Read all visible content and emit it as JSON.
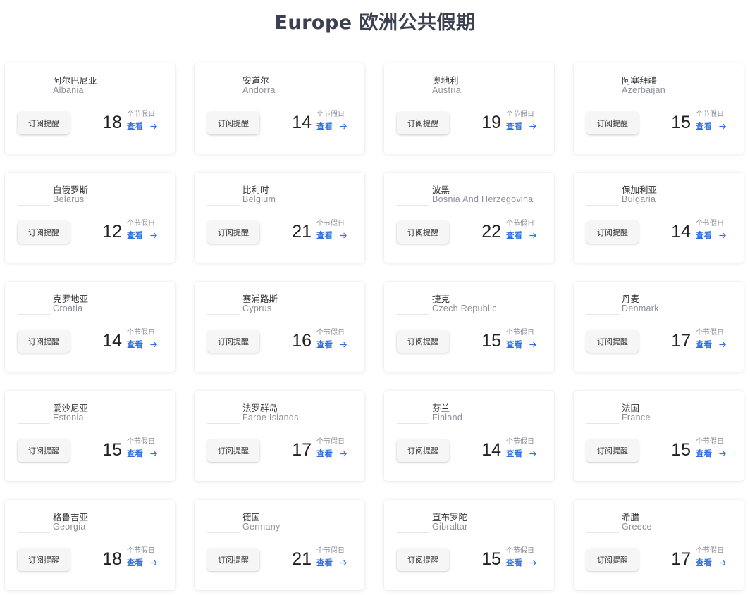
{
  "page": {
    "title": "Europe 欧洲公共假期"
  },
  "card_labels": {
    "subscribe": "订阅提醒",
    "holidays": "个节假日",
    "view": "查看"
  },
  "colors": {
    "link": "#2f6fde",
    "title": "#3b4150"
  },
  "countries": [
    {
      "cn": "阿尔巴尼亚",
      "en": "Albania",
      "count": "18"
    },
    {
      "cn": "安道尔",
      "en": "Andorra",
      "count": "14"
    },
    {
      "cn": "奥地利",
      "en": "Austria",
      "count": "19"
    },
    {
      "cn": "阿塞拜疆",
      "en": "Azerbaijan",
      "count": "15"
    },
    {
      "cn": "白俄罗斯",
      "en": "Belarus",
      "count": "12"
    },
    {
      "cn": "比利时",
      "en": "Belgium",
      "count": "21"
    },
    {
      "cn": "波黑",
      "en": "Bosnia And Herzegovina",
      "count": "22"
    },
    {
      "cn": "保加利亚",
      "en": "Bulgaria",
      "count": "14"
    },
    {
      "cn": "克罗地亚",
      "en": "Croatia",
      "count": "14"
    },
    {
      "cn": "塞浦路斯",
      "en": "Cyprus",
      "count": "16"
    },
    {
      "cn": "捷克",
      "en": "Czech Republic",
      "count": "15"
    },
    {
      "cn": "丹麦",
      "en": "Denmark",
      "count": "17"
    },
    {
      "cn": "爱沙尼亚",
      "en": "Estonia",
      "count": "15"
    },
    {
      "cn": "法罗群岛",
      "en": "Faroe Islands",
      "count": "17"
    },
    {
      "cn": "芬兰",
      "en": "Finland",
      "count": "14"
    },
    {
      "cn": "法国",
      "en": "France",
      "count": "15"
    },
    {
      "cn": "格鲁吉亚",
      "en": "Georgia",
      "count": "18"
    },
    {
      "cn": "德国",
      "en": "Germany",
      "count": "21"
    },
    {
      "cn": "直布罗陀",
      "en": "Gibraltar",
      "count": "15"
    },
    {
      "cn": "希腊",
      "en": "Greece",
      "count": "17"
    }
  ]
}
